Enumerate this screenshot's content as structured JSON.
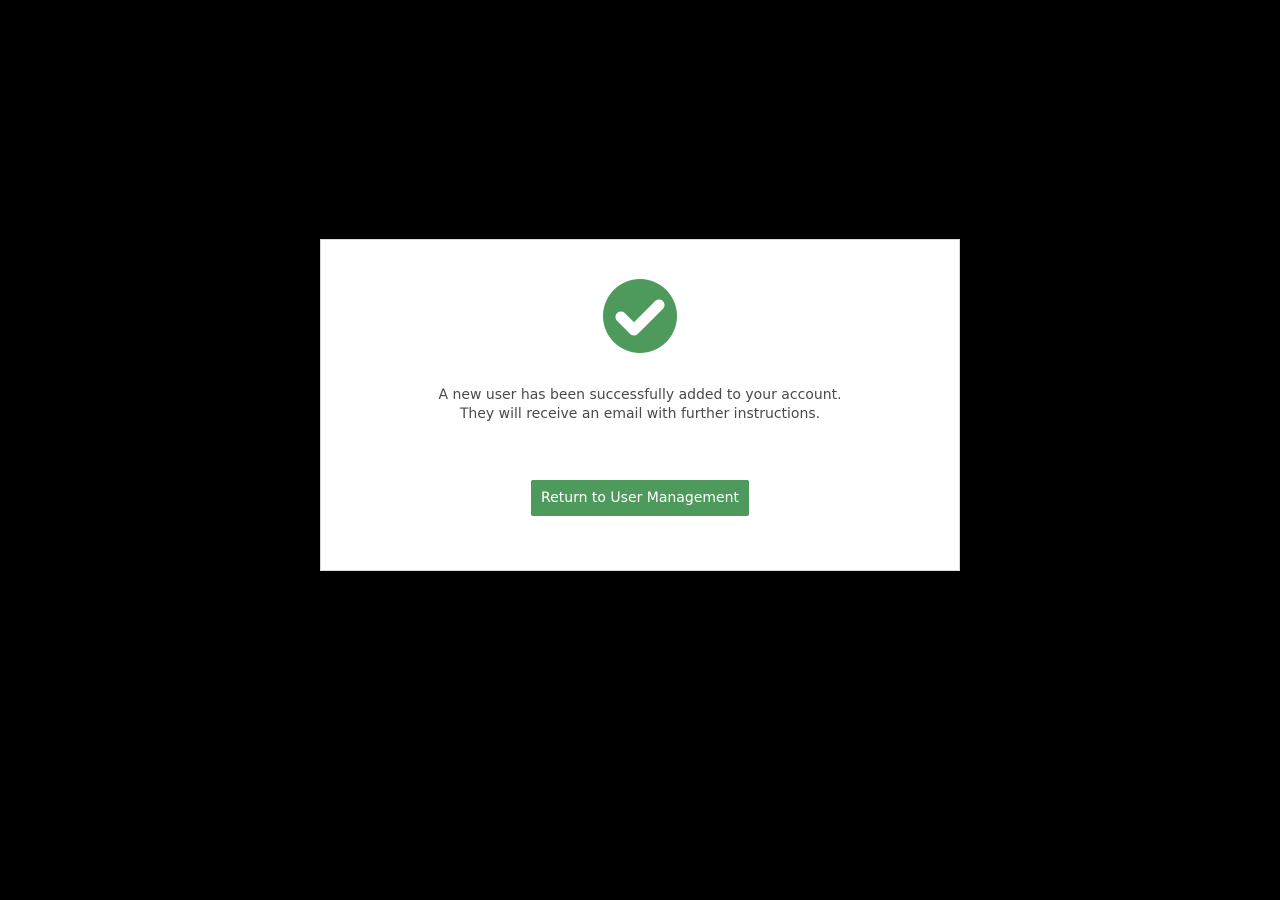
{
  "overlay": {
    "background": "#000000"
  },
  "dialog": {
    "icon": "check-circle-icon",
    "icon_color": "#4e9a5c",
    "message_line_1": "A new user has been successfully added to your account.",
    "message_line_2": "They will receive an email with further instructions.",
    "button_label": "Return to User Management",
    "button_color": "#4e9a5c"
  }
}
